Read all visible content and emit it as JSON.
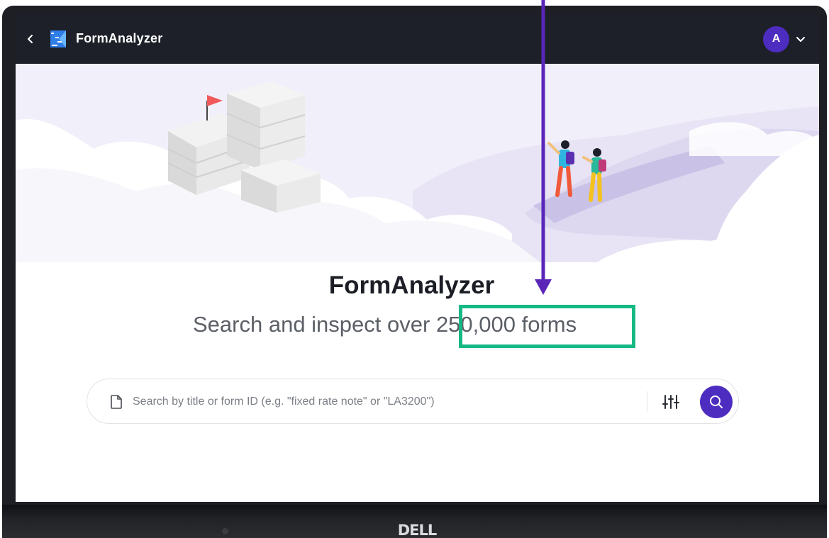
{
  "device": {
    "brand": "DELL"
  },
  "header": {
    "app_name": "FormAnalyzer",
    "user_initial": "A"
  },
  "main": {
    "title": "FormAnalyzer",
    "subtitle_prefix": "Search and inspect over ",
    "forms_count": "250,000 forms"
  },
  "search": {
    "placeholder": "Search by title or form ID (e.g. \"fixed rate note\" or \"LA3200\")"
  },
  "icons": {
    "back": "chevron-left-icon",
    "logo": "formanalyzer-logo",
    "user_menu": "chevron-down-icon",
    "document": "document-icon",
    "filter": "sliders-icon",
    "search": "search-icon"
  },
  "colors": {
    "header_bg": "#1d2029",
    "accent": "#4d2cc0",
    "annotation_arrow": "#5a26b8",
    "annotation_highlight": "#16b884"
  }
}
